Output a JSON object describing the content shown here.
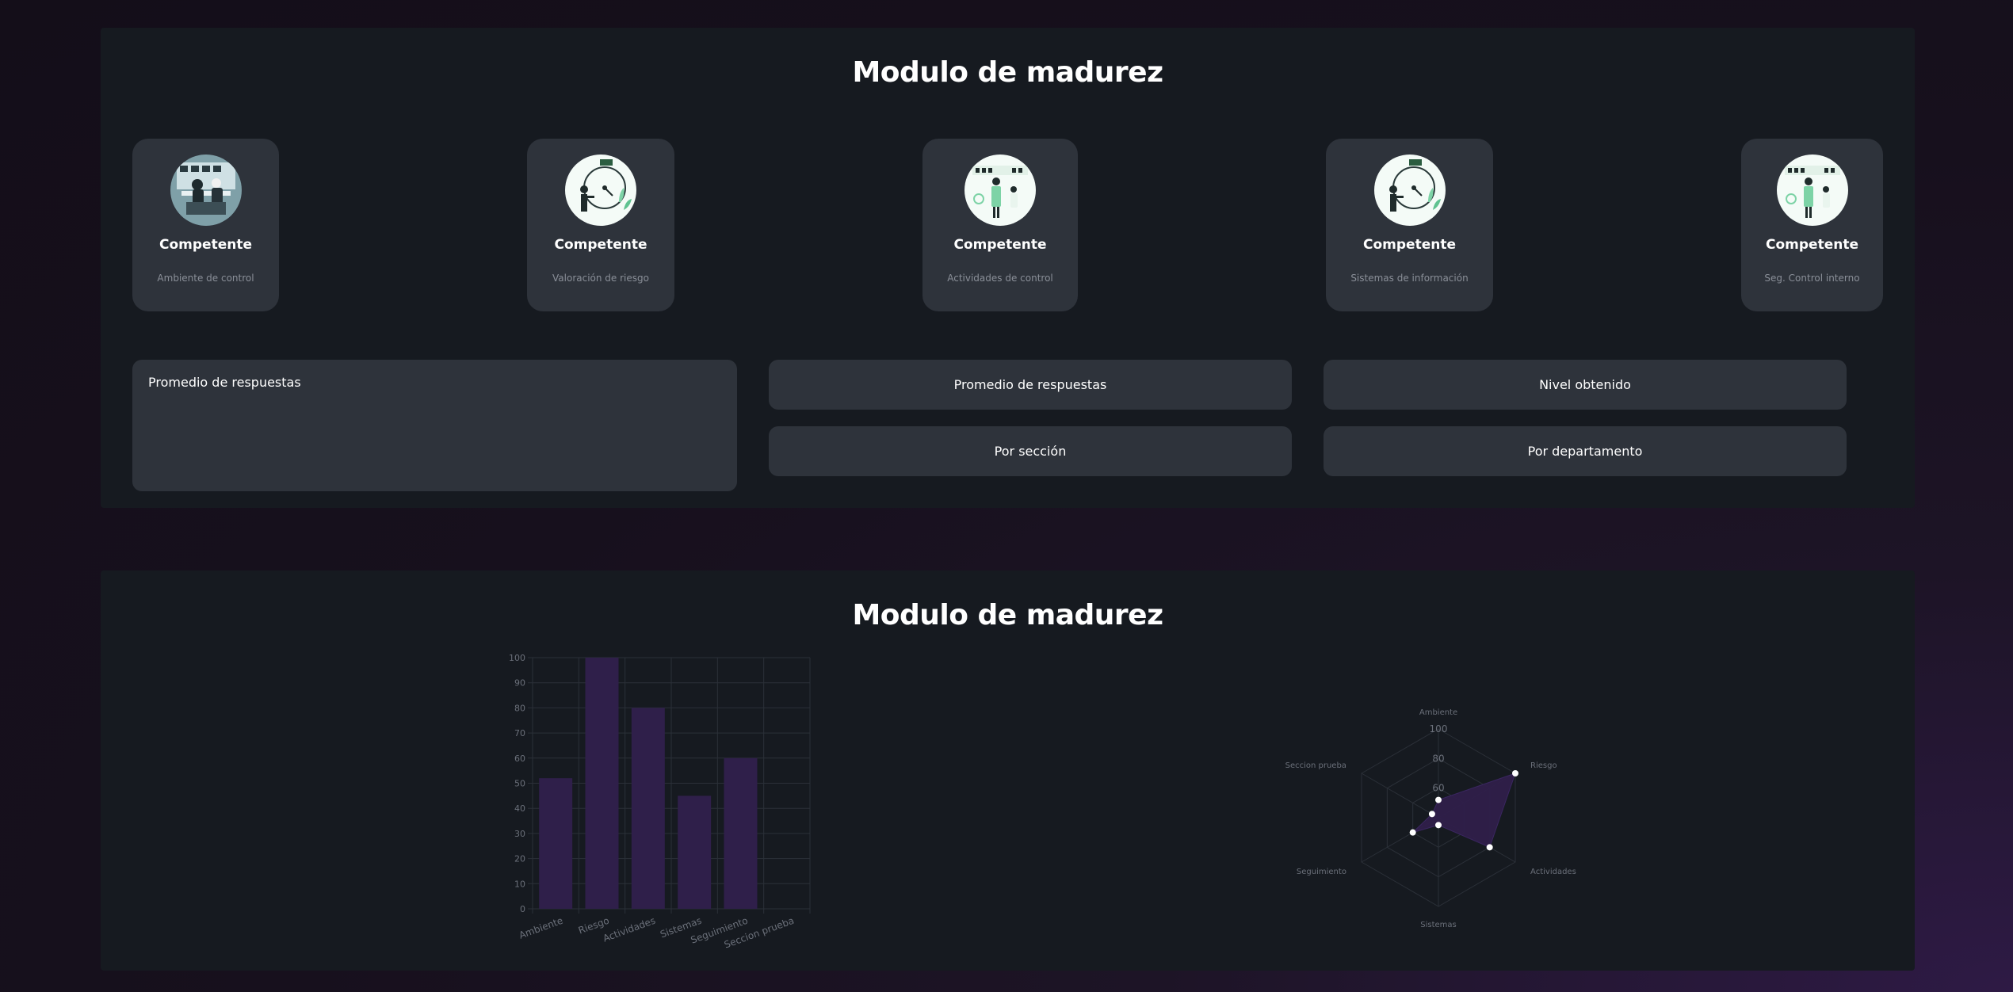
{
  "colors": {
    "background": "#17101d",
    "panel": "#161a20",
    "card": "#2e333b",
    "accent": "#2f1f4a"
  },
  "top_panel": {
    "title": "Modulo de madurez",
    "cards": [
      {
        "title": "Competente",
        "subtitle": "Ambiente de control",
        "icon": "office-workers-illustration"
      },
      {
        "title": "Competente",
        "subtitle": "Valoración de riesgo",
        "icon": "gauge-illustration"
      },
      {
        "title": "Competente",
        "subtitle": "Actividades de control",
        "icon": "dashboard-illustration"
      },
      {
        "title": "Competente",
        "subtitle": "Sistemas de información",
        "icon": "gauge-illustration"
      },
      {
        "title": "Competente",
        "subtitle": "Seg. Control interno",
        "icon": "dashboard-illustration"
      }
    ],
    "average_box_label": "Promedio de respuestas",
    "buttons": {
      "promedio": "Promedio de respuestas",
      "nivel": "Nivel obtenido",
      "seccion": "Por sección",
      "departamento": "Por departamento"
    }
  },
  "bottom_panel": {
    "title": "Modulo de madurez"
  },
  "chart_data": [
    {
      "type": "bar",
      "categories": [
        "Ambiente",
        "Riesgo",
        "Actividades",
        "Sistemas",
        "Seguimiento",
        "Seccion prueba"
      ],
      "values": [
        52,
        100,
        80,
        45,
        60,
        0
      ],
      "ylim": [
        0,
        100
      ],
      "yticks": [
        "0",
        "10",
        "20",
        "30",
        "40",
        "50",
        "60",
        "70",
        "80",
        "90",
        "100"
      ],
      "grid": true,
      "bar_color": "#2f1f4a"
    },
    {
      "type": "radar",
      "categories": [
        "Ambiente",
        "Riesgo",
        "Actividades",
        "Sistemas",
        "Seguimiento",
        "Seccion prueba"
      ],
      "values": [
        52,
        100,
        80,
        45,
        60,
        45
      ],
      "rlim": [
        40,
        100
      ],
      "rticks": [
        "60",
        "80",
        "100"
      ],
      "fill_color": "#2f1f4a",
      "point_color": "#ffffff"
    }
  ]
}
